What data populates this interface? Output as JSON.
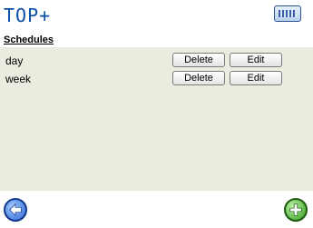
{
  "app": {
    "logo_text": "TOP+"
  },
  "header": {
    "keyboard_icon": "keyboard-icon"
  },
  "section": {
    "title": "Schedules"
  },
  "schedules": [
    {
      "name": "day",
      "delete_label": "Delete",
      "edit_label": "Edit"
    },
    {
      "name": "week",
      "delete_label": "Delete",
      "edit_label": "Edit"
    }
  ],
  "footer": {
    "back_icon": "back-arrow-icon",
    "add_icon": "add-icon"
  },
  "colors": {
    "panel": "#ecebdf",
    "logo": "#0a4fa8",
    "back": "#2f69d6",
    "add": "#2e9a1a"
  }
}
